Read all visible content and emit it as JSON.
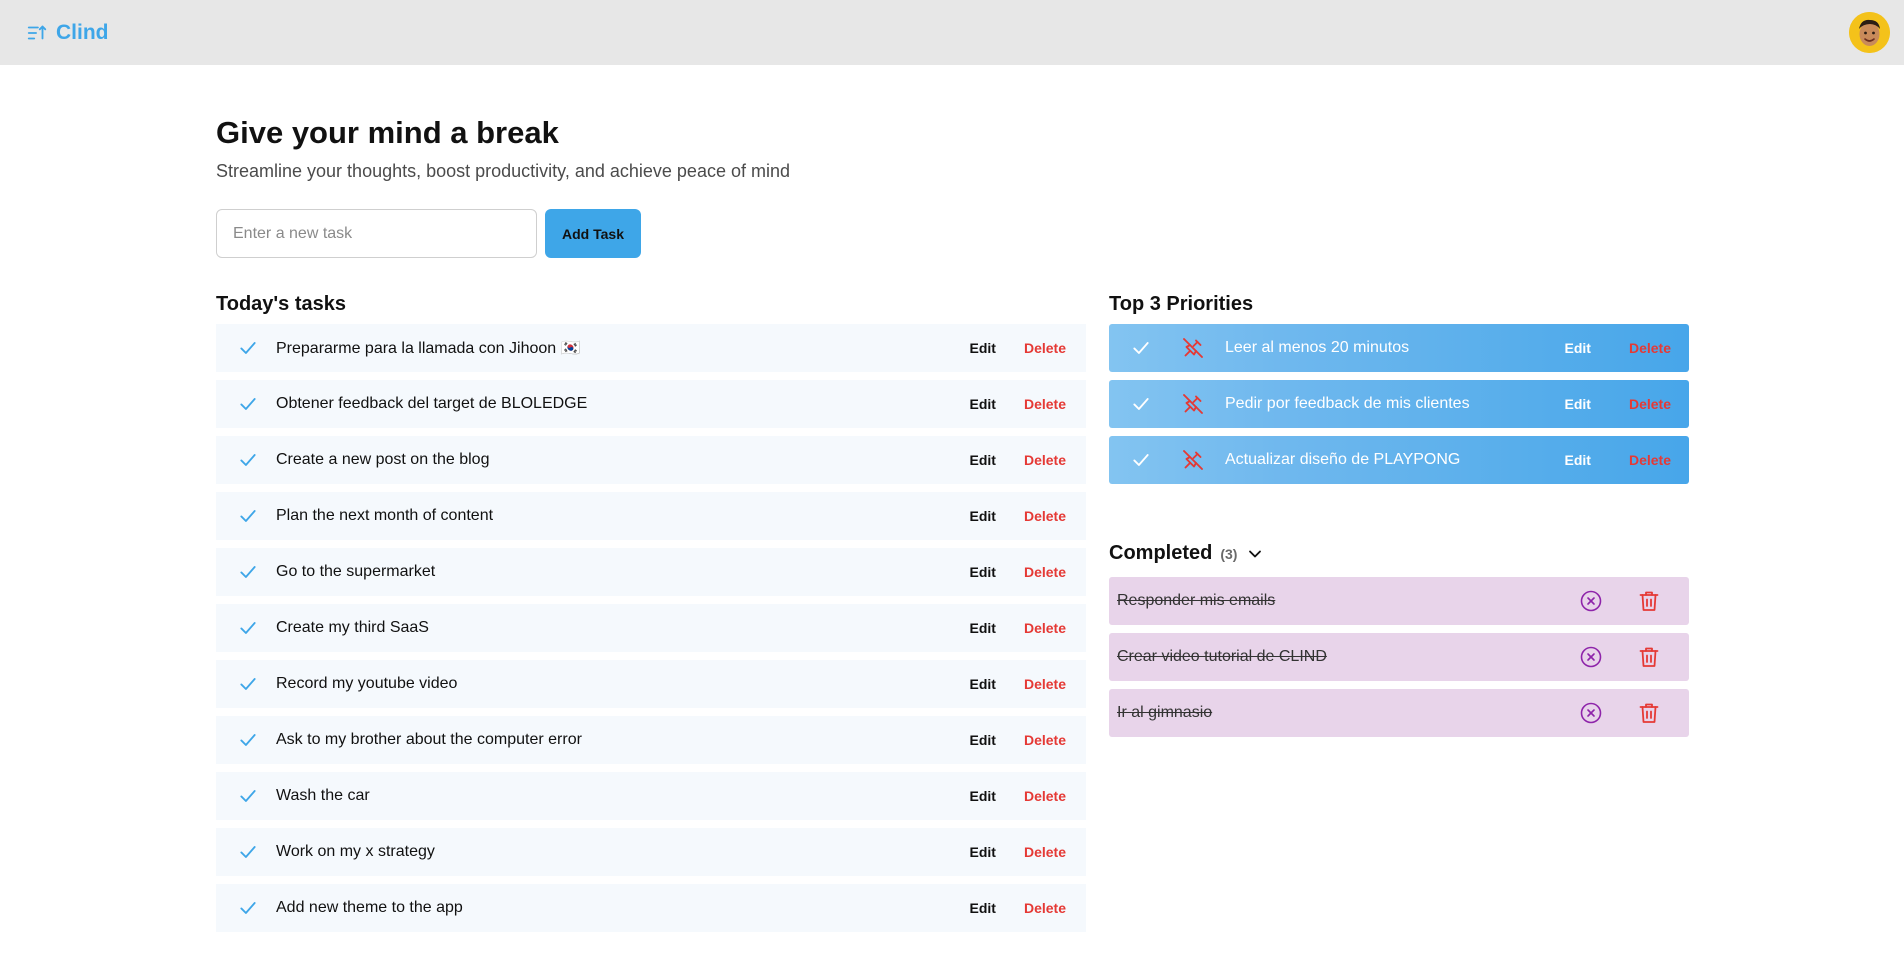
{
  "header": {
    "brand": "Clind"
  },
  "hero": {
    "title": "Give your mind a break",
    "subtitle": "Streamline your thoughts, boost productivity, and achieve peace of mind"
  },
  "new_task": {
    "placeholder": "Enter a new task",
    "value": "",
    "add_label": "Add Task"
  },
  "today": {
    "title": "Today's tasks",
    "edit_label": "Edit",
    "delete_label": "Delete",
    "tasks": [
      "Prepararme para la llamada con Jihoon 🇰🇷",
      "Obtener feedback del target de BLOLEDGE",
      "Create a new post on the blog",
      "Plan the next month of content",
      "Go to the supermarket",
      "Create my third SaaS",
      "Record my youtube video",
      "Ask to my brother about the computer error",
      "Wash the car",
      "Work on my x strategy",
      "Add new theme to the app"
    ]
  },
  "priorities": {
    "title": "Top 3 Priorities",
    "edit_label": "Edit",
    "delete_label": "Delete",
    "items": [
      "Leer al menos 20 minutos",
      "Pedir por feedback de mis clientes",
      "Actualizar diseño de PLAYPONG"
    ]
  },
  "completed": {
    "title": "Completed",
    "count": "(3)",
    "items": [
      "Responder mis emails",
      "Crear video tutorial de CLIND",
      "Ir al gimnasio"
    ]
  },
  "colors": {
    "accent": "#3ea6e8",
    "danger": "#e53935",
    "completed_bg": "#e8d4ea",
    "completed_icon": "#8e24aa",
    "header_bg": "#e7e7e7"
  },
  "icons": {
    "brand": "sort-list-icon",
    "task": "check-icon",
    "priority_pin": "unpin-icon",
    "completed_restore": "circle-x-icon",
    "completed_remove": "trash-icon",
    "completed_toggle": "chevron-down-icon"
  }
}
